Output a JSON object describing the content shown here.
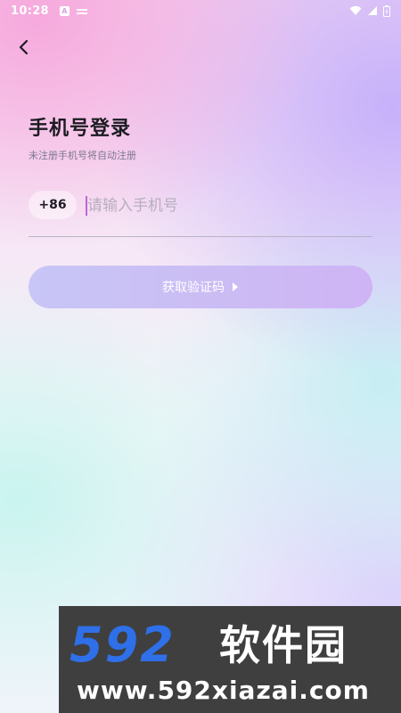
{
  "status_bar": {
    "time": "10:28",
    "notif_a_label": "A",
    "icons": [
      "app-notification-icon",
      "message-notification-icon",
      "wifi-icon",
      "signal-icon",
      "battery-icon"
    ]
  },
  "header": {
    "back_icon": "chevron-left-icon"
  },
  "login": {
    "title": "手机号登录",
    "subtitle": "未注册手机号将自动注册",
    "country_code": "+86",
    "phone_placeholder": "请输入手机号",
    "phone_value": "",
    "get_code_label": "获取验证码",
    "get_code_icon": "chevron-right-icon"
  },
  "watermark": {
    "logo_digits": "592",
    "logo_text": "软件园",
    "url": "www.592xiazai.com"
  },
  "colors": {
    "title": "#1b1b22",
    "subtitle": "#7c7790",
    "placeholder": "#b7aebf",
    "cursor": "#c266d6",
    "button_start": "#c8c6f6",
    "button_end": "#cfb4f5",
    "watermark_bg": "#3f3f3f",
    "watermark_accent": "#2f6fe8"
  }
}
